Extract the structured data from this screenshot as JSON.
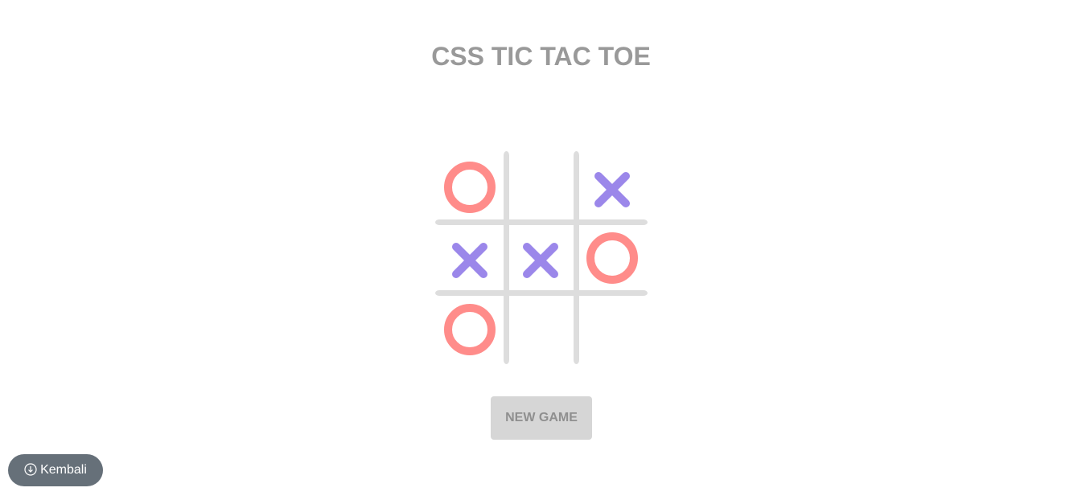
{
  "title": "CSS TIC TAC TOE",
  "board": {
    "cells": [
      "O",
      "",
      "X",
      "X",
      "X",
      "O",
      "O",
      "",
      ""
    ]
  },
  "colors": {
    "o_mark": "#ff8c8a",
    "x_mark": "#9b87ea",
    "grid": "#dddddd",
    "title": "#999999"
  },
  "buttons": {
    "new_game": "NEW GAME",
    "back": "Kembali"
  },
  "icons": {
    "back": "arrow-down-circle-icon"
  }
}
